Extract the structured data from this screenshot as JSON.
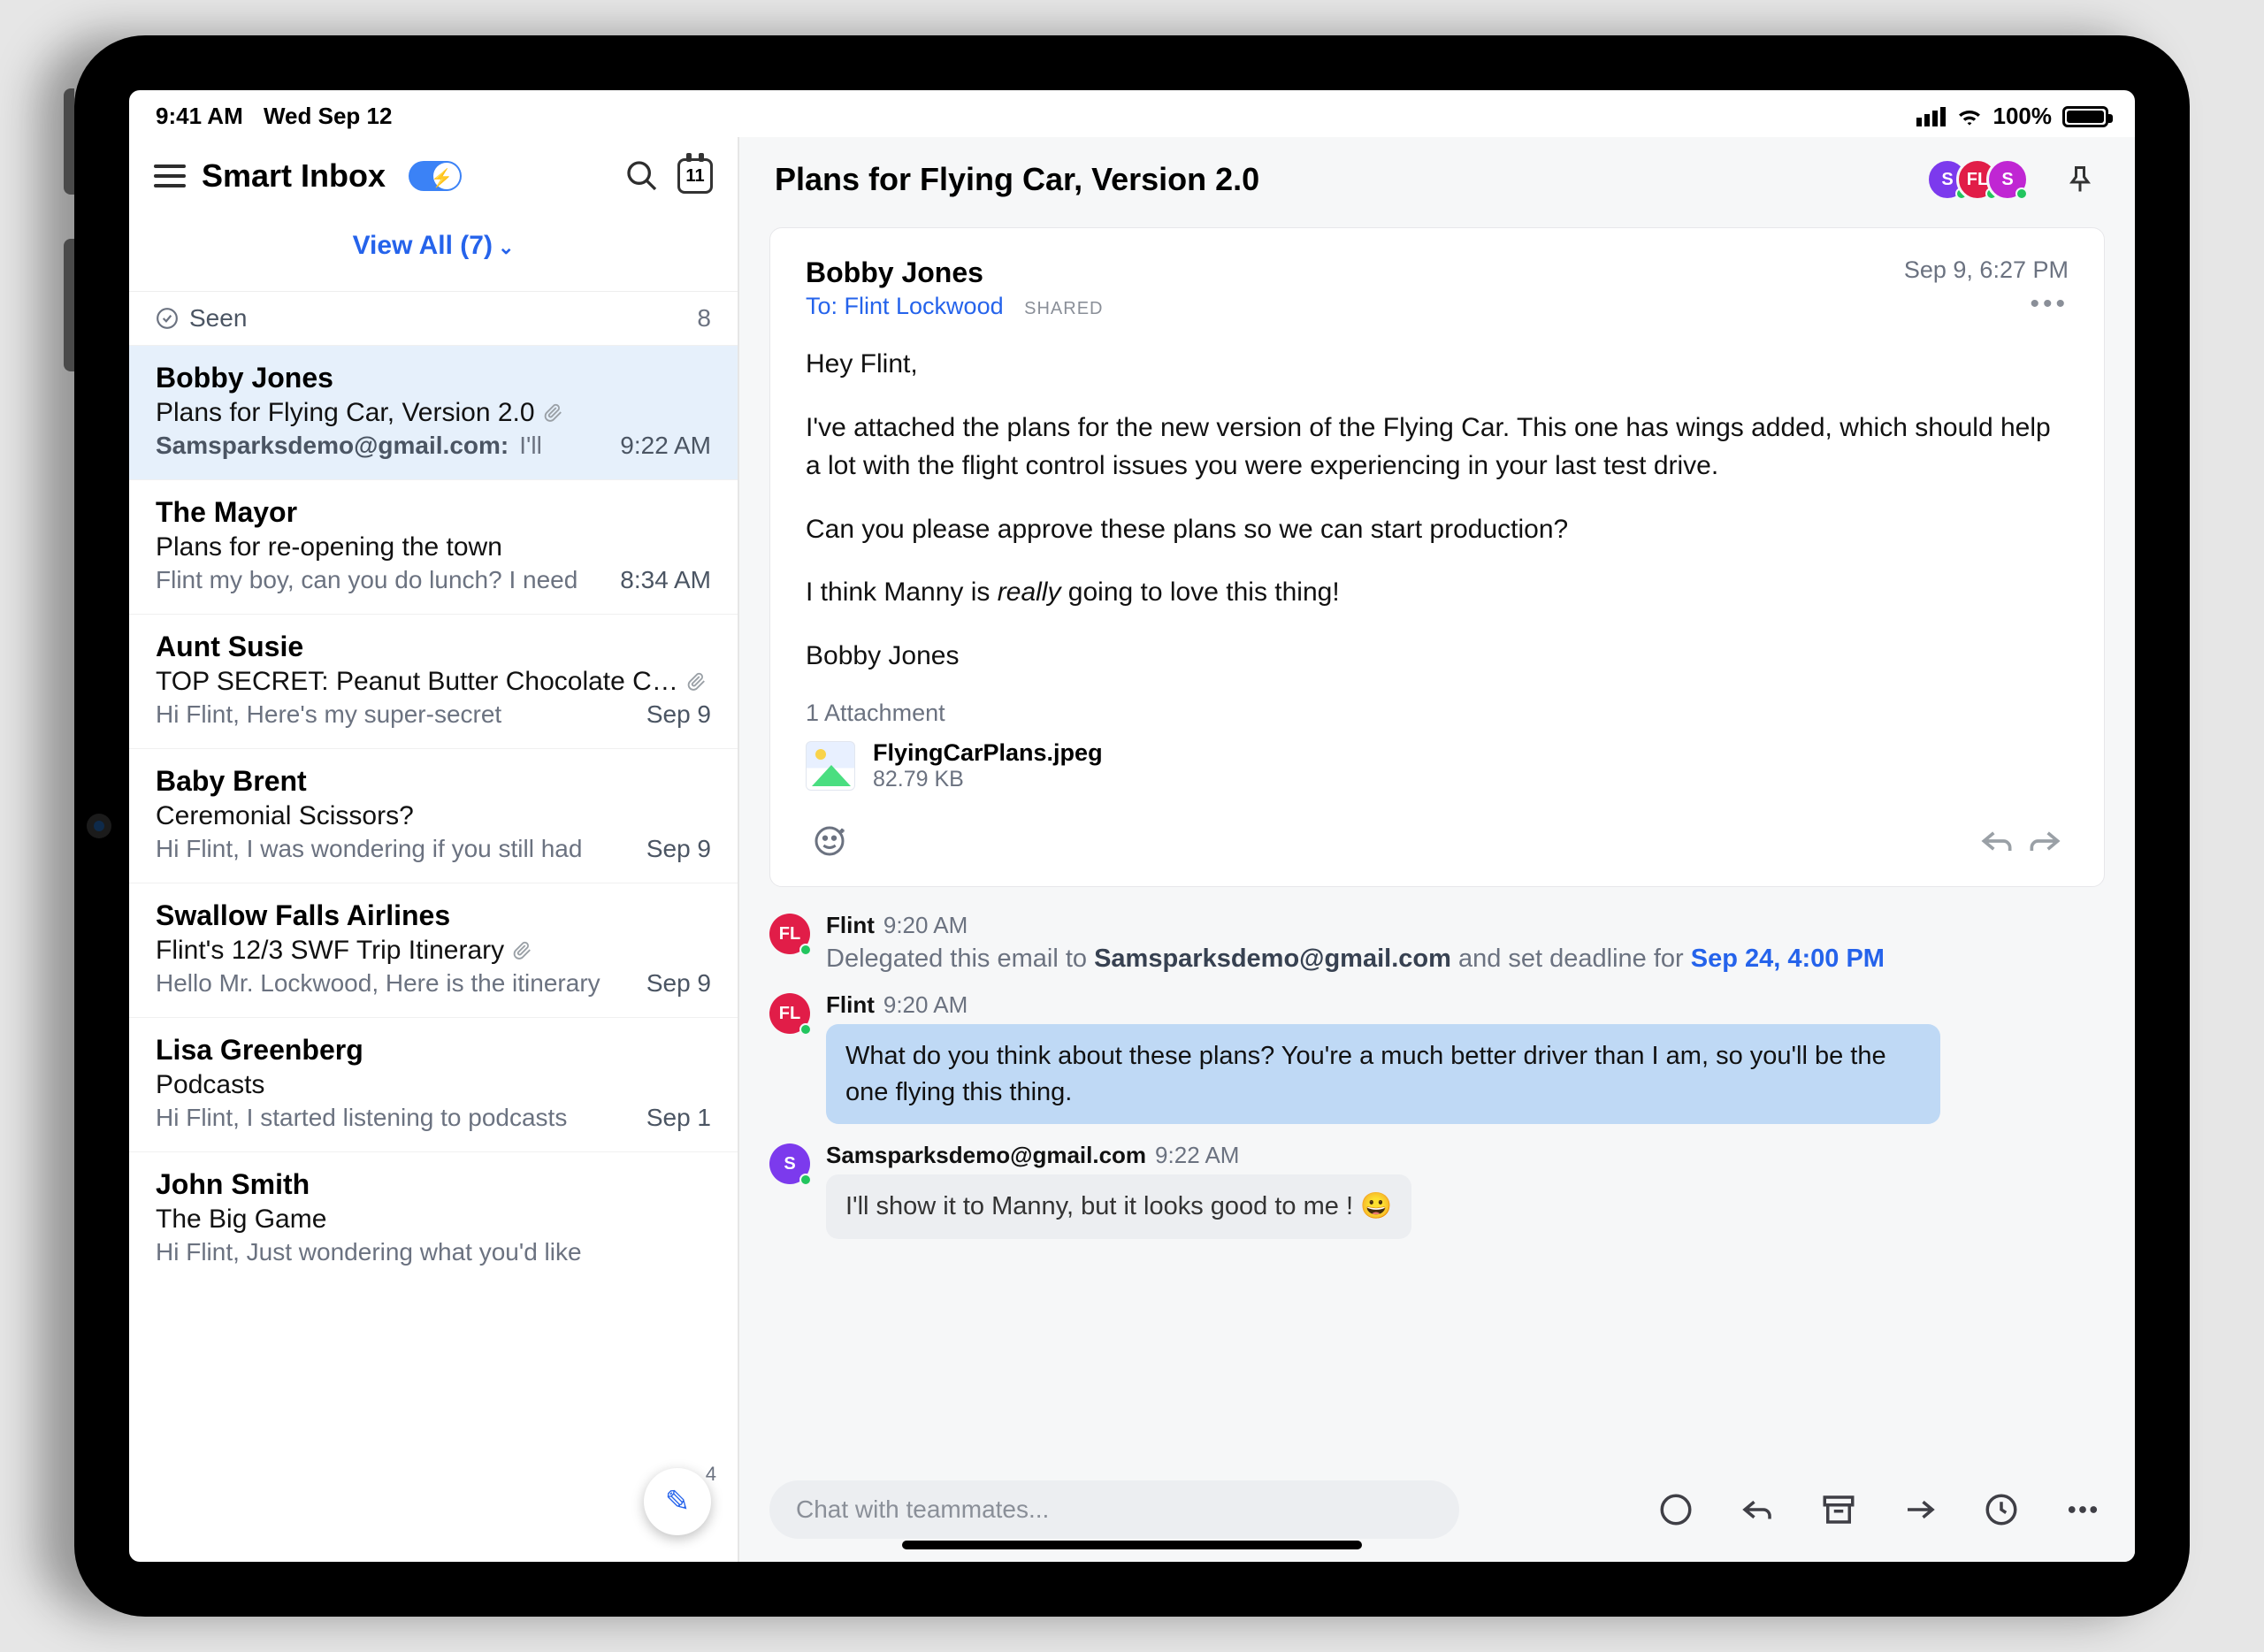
{
  "status": {
    "time": "9:41 AM",
    "date": "Wed Sep 12",
    "battery": "100%"
  },
  "sidebar": {
    "title": "Smart Inbox",
    "calendar_day": "11",
    "view_all": "View All (7)",
    "seen_label": "Seen",
    "seen_count": "8",
    "compose_badge": "4",
    "items": [
      {
        "name": "Bobby Jones",
        "subject": "Plans for Flying Car, Version 2.0",
        "attachment": true,
        "who": "Samsparksdemo@gmail.com:",
        "snippet": "I'll",
        "time": "9:22 AM",
        "selected": true
      },
      {
        "name": "The Mayor",
        "subject": "Plans for re-opening the town",
        "attachment": false,
        "snippet": "Flint my boy, can you do lunch? I need",
        "time": "8:34 AM",
        "selected": false
      },
      {
        "name": "Aunt Susie",
        "subject": "TOP SECRET: Peanut Butter Chocolate C…",
        "attachment": true,
        "snippet": "Hi Flint, Here's my super-secret",
        "time": "Sep 9",
        "selected": false
      },
      {
        "name": "Baby Brent",
        "subject": "Ceremonial Scissors?",
        "attachment": false,
        "snippet": "Hi Flint, I was wondering if you still had",
        "time": "Sep 9",
        "selected": false
      },
      {
        "name": "Swallow Falls Airlines",
        "subject": "Flint's 12/3 SWF Trip Itinerary",
        "attachment": true,
        "snippet": "Hello Mr. Lockwood, Here is the itinerary",
        "time": "Sep 9",
        "selected": false
      },
      {
        "name": "Lisa Greenberg",
        "subject": "Podcasts",
        "attachment": false,
        "snippet": "Hi Flint, I started listening to podcasts",
        "time": "Sep 1",
        "selected": false
      },
      {
        "name": "John Smith",
        "subject": "The Big Game",
        "attachment": false,
        "snippet": "Hi Flint, Just wondering what you'd like",
        "time": "",
        "selected": false
      }
    ]
  },
  "thread": {
    "title": "Plans for Flying Car, Version 2.0",
    "participants": [
      {
        "initials": "S",
        "color": "#7c3aed"
      },
      {
        "initials": "FL",
        "color": "#e11d48"
      },
      {
        "initials": "S",
        "color": "#c026d3"
      }
    ],
    "message": {
      "from": "Bobby Jones",
      "to": "To: Flint Lockwood",
      "shared": "SHARED",
      "date": "Sep 9, 6:27 PM",
      "greeting": "Hey Flint,",
      "p1": "I've attached the plans for the new version of the Flying Car. This one has wings added, which should help a lot with the flight control issues you were experiencing in your last test drive.",
      "p2": "Can you please approve these plans so we can start production?",
      "p3_before": "I think Manny is ",
      "p3_em": "really",
      "p3_after": " going to love this thing!",
      "sig": "Bobby Jones",
      "attach_label": "1 Attachment",
      "file_name": "FlyingCarPlans.jpeg",
      "file_size": "82.79 KB"
    },
    "chat": [
      {
        "author": "Flint",
        "time": "9:20 AM",
        "avatar": "FL",
        "color": "#e11d48",
        "type": "delegation",
        "text_before": "Delegated this email to ",
        "assignee": "Samsparksdemo@gmail.com",
        "text_mid": " and set deadline for ",
        "deadline": "Sep 24, 4:00 PM"
      },
      {
        "author": "Flint",
        "time": "9:20 AM",
        "avatar": "FL",
        "color": "#e11d48",
        "type": "bubble-blue",
        "text": "What do you think about these plans? You're a much better driver than I am, so you'll be the one flying this thing."
      },
      {
        "author": "Samsparksdemo@gmail.com",
        "time": "9:22 AM",
        "avatar": "S",
        "color": "#7c3aed",
        "type": "bubble-gray",
        "text": "I'll show it to Manny, but it looks good to me ! 😀"
      }
    ],
    "input_placeholder": "Chat with teammates..."
  }
}
